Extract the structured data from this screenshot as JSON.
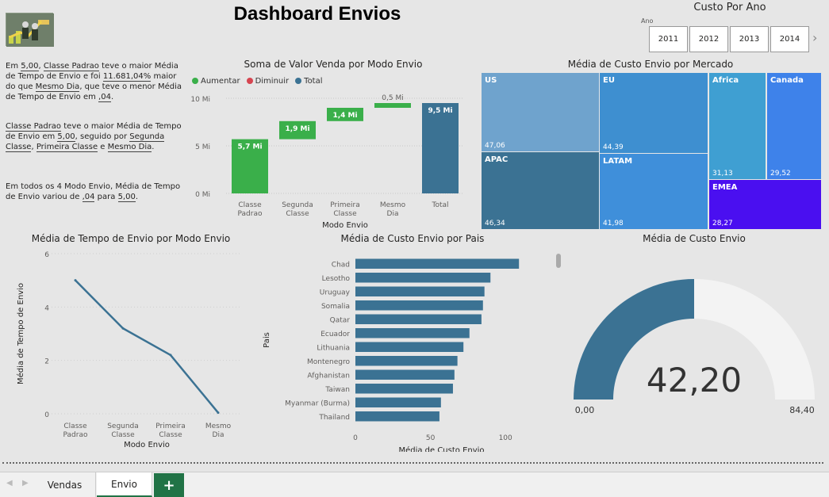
{
  "header": {
    "title": "Dashboard Envios"
  },
  "slicer": {
    "title": "Custo Por Ano",
    "label": "Ano",
    "years": [
      "2011",
      "2012",
      "2013",
      "2014"
    ]
  },
  "narrative": {
    "p1": {
      "a": "Em ",
      "v1": "5,00",
      "b": ", ",
      "v2": "Classe Padrao",
      "c": " teve o maior Média de Tempo de Envio e foi ",
      "v3": "11.681,04%",
      "d": " maior do que ",
      "v4": "Mesmo Dia",
      "e": ", que teve o menor Média de Tempo de Envio em ",
      "v5": ",04",
      "f": "."
    },
    "p2": {
      "v1": "Classe Padrao",
      "a": " teve o maior Média de Tempo de Envio em ",
      "v2": "5,00",
      "b": ", seguido por ",
      "v3": "Segunda Classe",
      "c": ", ",
      "v4": "Primeira Classe",
      "d": " e ",
      "v5": "Mesmo Dia",
      "e": "."
    },
    "p3": {
      "a": "Em todos os 4 Modo Envio, Média de Tempo de Envio variou de ",
      "v1": ",04",
      "b": " para ",
      "v2": "5,00",
      "c": "."
    }
  },
  "waterfall": {
    "title": "Soma de Valor Venda por Modo Envio",
    "legend": [
      {
        "label": "Aumentar",
        "color": "#3aaf4a"
      },
      {
        "label": "Diminuir",
        "color": "#d64550"
      },
      {
        "label": "Total",
        "color": "#3b7293"
      }
    ],
    "xlabel": "Modo Envio"
  },
  "treemap": {
    "title": "Média de Custo Envio por Mercado",
    "tiles": [
      {
        "name": "US",
        "value": "47,06",
        "color": "#6fa3cd"
      },
      {
        "name": "APAC",
        "value": "46,34",
        "color": "#3b7293"
      },
      {
        "name": "EU",
        "value": "44,39",
        "color": "#3e8fd0"
      },
      {
        "name": "LATAM",
        "value": "41,98",
        "color": "#3f8fda"
      },
      {
        "name": "Africa",
        "value": "31,13",
        "color": "#3f9fd2"
      },
      {
        "name": "Canada",
        "value": "29,52",
        "color": "#3e82ea"
      },
      {
        "name": "EMEA",
        "value": "28,27",
        "color": "#4a0ff0"
      }
    ]
  },
  "gauge": {
    "title": "Média de Custo Envio",
    "value_label": "42,20",
    "min_label": "0,00",
    "max_label": "84,40",
    "fill_color": "#3b7293",
    "track_color": "#f3f3f3"
  },
  "tabs": {
    "vendas": "Vendas",
    "envio": "Envio",
    "add": "+"
  },
  "chart_data": [
    {
      "type": "bar",
      "subtype": "waterfall",
      "title": "Soma de Valor Venda por Modo Envio",
      "xlabel": "Modo Envio",
      "ylabel": "",
      "categories": [
        "Classe Padrao",
        "Segunda Classe",
        "Primeira Classe",
        "Mesmo Dia",
        "Total"
      ],
      "values": [
        5.7,
        1.9,
        1.4,
        0.5,
        9.5
      ],
      "data_labels": [
        "5,7 Mi",
        "1,9 Mi",
        "1,4 Mi",
        "0,5 Mi",
        "9,5 Mi"
      ],
      "yticks": [
        "0 Mi",
        "5 Mi",
        "10 Mi"
      ],
      "ylim": [
        0,
        10
      ],
      "grid": true
    },
    {
      "type": "line",
      "title": "Média de Tempo de Envio por Modo Envio",
      "xlabel": "Modo Envio",
      "ylabel": "Média de Tempo de Envio",
      "categories": [
        "Classe Padrao",
        "Segunda Classe",
        "Primeira Classe",
        "Mesmo Dia"
      ],
      "values": [
        5.0,
        3.2,
        2.2,
        0.04
      ],
      "yticks": [
        "0",
        "2",
        "4",
        "6"
      ],
      "ylim": [
        0,
        6
      ],
      "color": "#3b7293",
      "grid": true
    },
    {
      "type": "bar",
      "orientation": "horizontal",
      "title": "Média de Custo Envio por Pais",
      "xlabel": "Média de Custo Envio",
      "ylabel": "Pais",
      "categories": [
        "Chad",
        "Lesotho",
        "Uruguay",
        "Somalia",
        "Qatar",
        "Ecuador",
        "Lithuania",
        "Montenegro",
        "Afghanistan",
        "Taiwan",
        "Myanmar (Burma)",
        "Thailand"
      ],
      "values": [
        109,
        90,
        86,
        85,
        84,
        76,
        72,
        68,
        66,
        65,
        57,
        56
      ],
      "xticks": [
        "0",
        "50",
        "100"
      ],
      "xlim": [
        0,
        120
      ],
      "color": "#3b7293",
      "grid": false
    }
  ]
}
